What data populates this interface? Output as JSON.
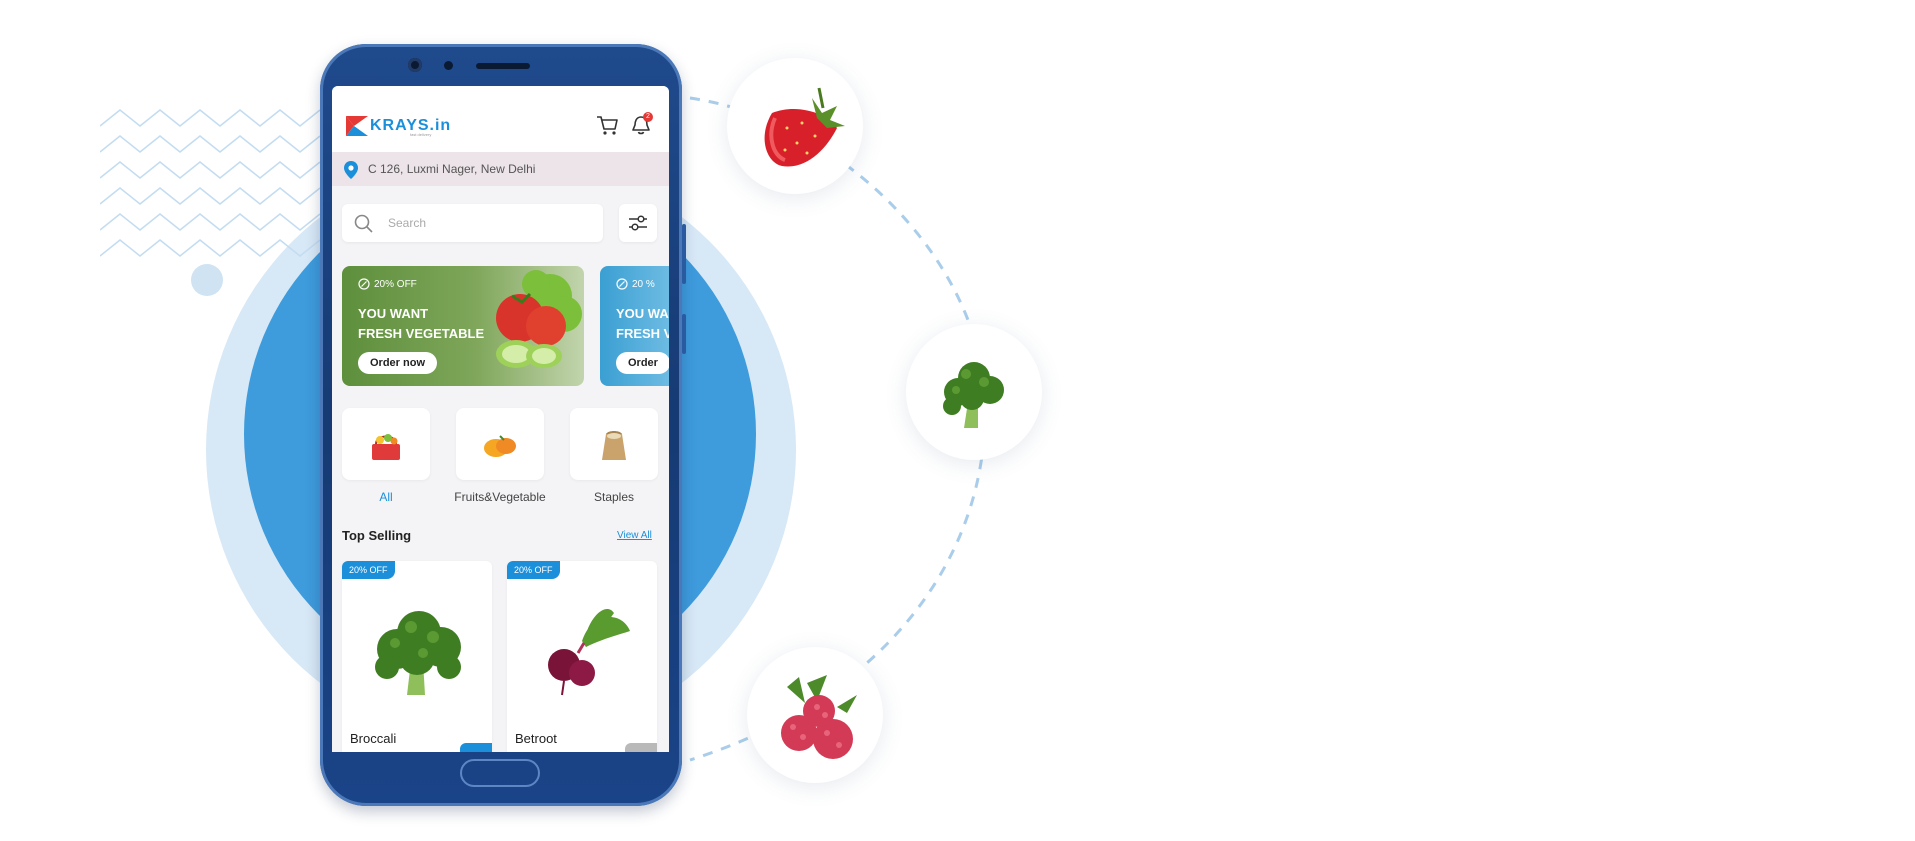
{
  "app": {
    "logo_text": "KRAYS.in",
    "logo_tagline": "fast delivery"
  },
  "header": {
    "notification_count": "2",
    "cart_icon": "cart-icon",
    "bell_icon": "bell-icon"
  },
  "address": {
    "icon": "location-pin-icon",
    "text": "C 126, Luxmi Nager, New Delhi"
  },
  "search": {
    "placeholder": "Search",
    "filter_icon": "filter-sliders-icon"
  },
  "banners": [
    {
      "badge": "20% OFF",
      "title_line1": "YOU WANT",
      "title_line2": "FRESH VEGETABLE",
      "button": "Order now"
    },
    {
      "badge": "20 %",
      "title_line1": "YOU WA",
      "title_line2": "FRESH V",
      "button": "Order"
    }
  ],
  "categories": [
    {
      "label": "All",
      "active": true
    },
    {
      "label": "Fruits&Vegetable",
      "active": false
    },
    {
      "label": "Staples",
      "active": false
    }
  ],
  "top_selling": {
    "title": "Top Selling",
    "view_all": "View All",
    "products": [
      {
        "name": "Broccali",
        "badge": "20% OFF"
      },
      {
        "name": "Betroot",
        "badge": "20% OFF"
      }
    ]
  },
  "colors": {
    "brand_blue": "#1b8fd9",
    "bg_circle": "#3e9bdc",
    "phone_body": "#1f4a8c"
  }
}
